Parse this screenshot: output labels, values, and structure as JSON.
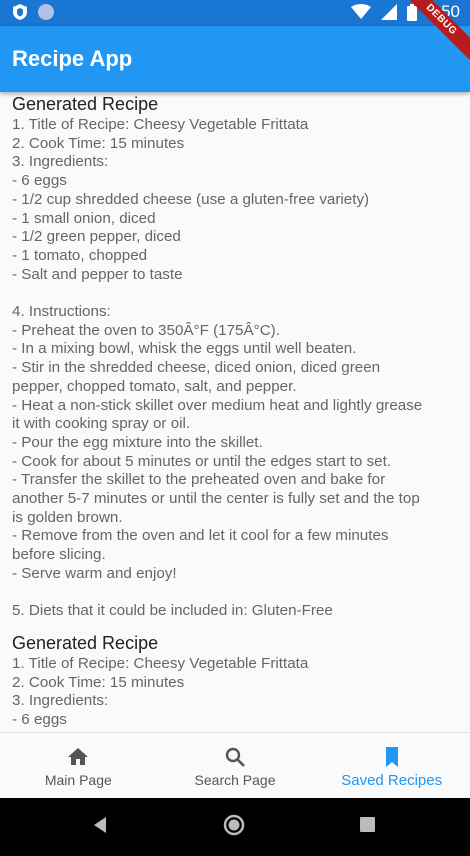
{
  "status_bar": {
    "time": "4:50"
  },
  "app_bar": {
    "title": "Recipe App",
    "debug": "DEBUG"
  },
  "recipes": [
    {
      "heading": "Generated Recipe",
      "lines": [
        "1. Title of Recipe: Cheesy Vegetable Frittata",
        "2. Cook Time: 15 minutes",
        "3. Ingredients:",
        "- 6 eggs",
        "- 1/2 cup shredded cheese (use a gluten-free variety)",
        "- 1 small onion, diced",
        "- 1/2 green pepper, diced",
        "- 1 tomato, chopped",
        "- Salt and pepper to taste",
        "",
        "4. Instructions:",
        "- Preheat the oven to 350Â°F (175Â°C).",
        "- In a mixing bowl, whisk the eggs until well beaten.",
        "- Stir in the shredded cheese, diced onion, diced green",
        "pepper, chopped tomato, salt, and pepper.",
        "- Heat a non-stick skillet over medium heat and lightly grease",
        "it with cooking spray or oil.",
        "- Pour the egg mixture into the skillet.",
        "- Cook for about 5 minutes or until the edges start to set.",
        "- Transfer the skillet to the preheated oven and bake for",
        "another 5-7 minutes or until the center is fully set and the top",
        "is golden brown.",
        "- Remove from the oven and let it cool for a few minutes",
        "before slicing.",
        "- Serve warm and enjoy!",
        "",
        "5. Diets that it could be included in: Gluten-Free"
      ]
    },
    {
      "heading": "Generated Recipe",
      "lines": [
        "1. Title of Recipe: Cheesy Vegetable Frittata",
        "2. Cook Time: 15 minutes",
        "3. Ingredients:",
        "- 6 eggs",
        "- 1/2 cup shredded cheese (use a gluten-free variety)"
      ]
    }
  ],
  "bottom_nav": {
    "items": [
      {
        "label": "Main Page",
        "icon": "home-icon",
        "active": false
      },
      {
        "label": "Search Page",
        "icon": "search-icon",
        "active": false
      },
      {
        "label": "Saved Recipes",
        "icon": "bookmark-icon",
        "active": true
      }
    ]
  },
  "colors": {
    "primary": "#2196f3",
    "status": "#1976d2",
    "text_muted": "#666666"
  }
}
